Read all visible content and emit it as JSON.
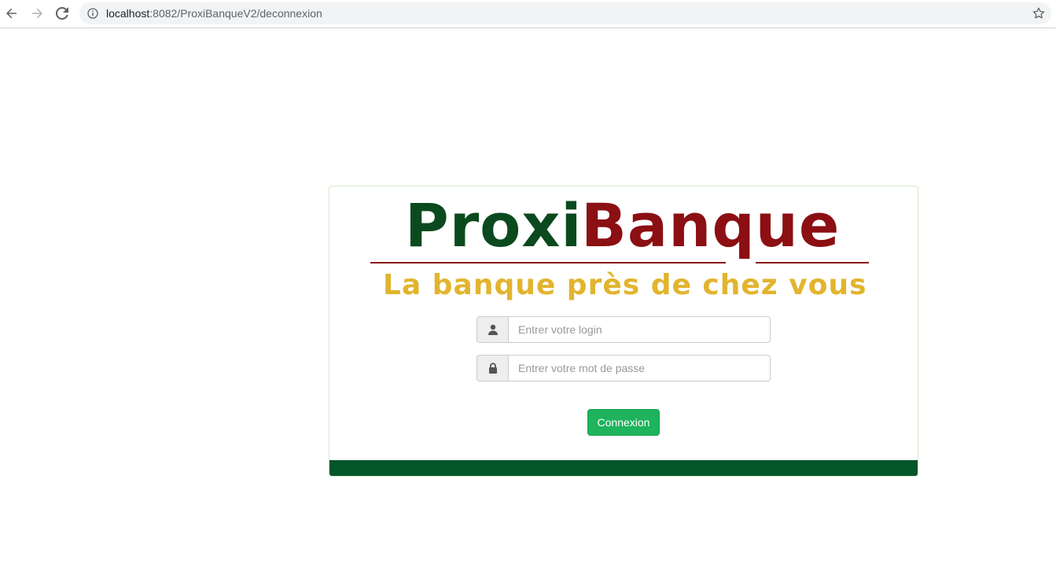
{
  "browser": {
    "url_host": "localhost",
    "url_path": ":8082/ProxiBanqueV2/deconnexion",
    "icons": {
      "back": "arrow-left-icon",
      "forward": "arrow-right-icon",
      "reload": "reload-icon",
      "site_info": "info-icon",
      "bookmark": "star-icon"
    }
  },
  "logo": {
    "part1": "Proxi",
    "part2": "Banque",
    "tagline": "La banque près de chez vous",
    "colors": {
      "proxi": "#0b4a1e",
      "banque": "#8b0f13",
      "tagline": "#e2b42e"
    }
  },
  "form": {
    "login_placeholder": "Entrer votre login",
    "password_placeholder": "Entrer votre mot de passe",
    "submit_label": "Connexion",
    "icons": {
      "login": "user-icon",
      "password": "lock-icon"
    }
  },
  "colors": {
    "button": "#1eb35c",
    "footer_bar": "#03552a"
  }
}
